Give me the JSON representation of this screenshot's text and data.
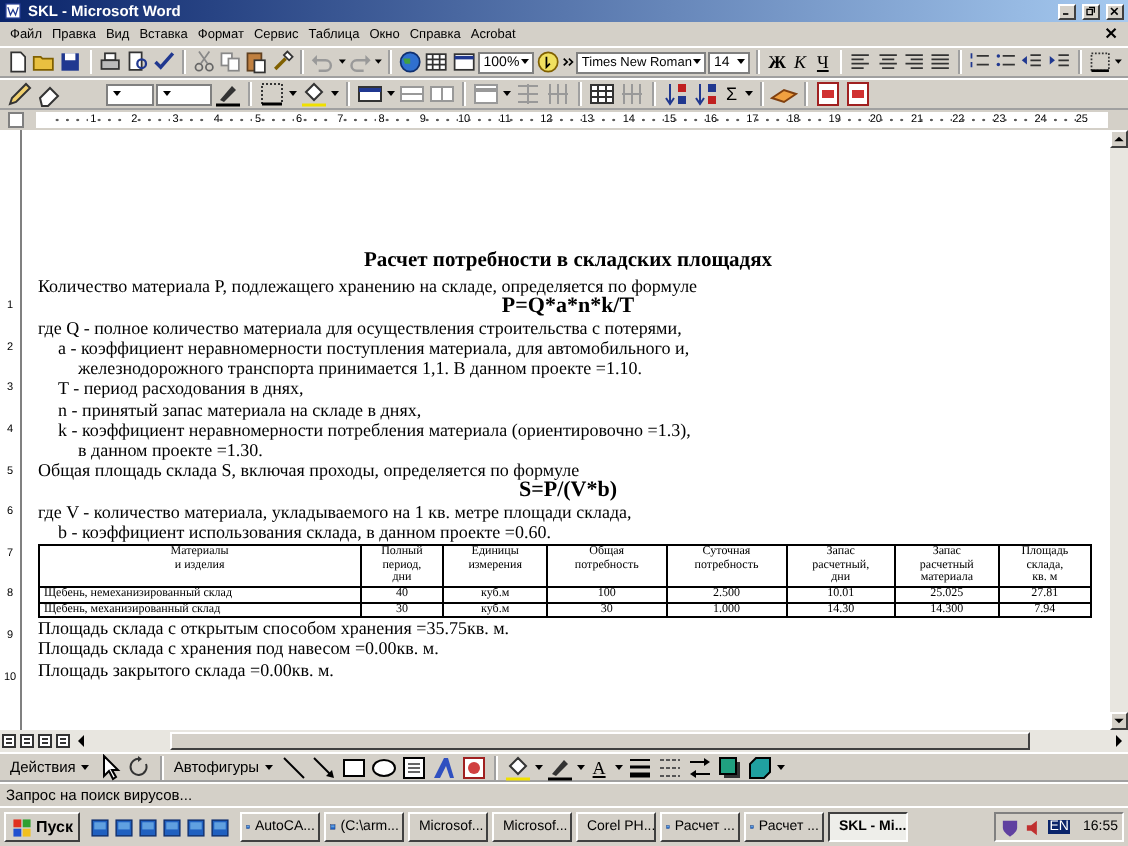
{
  "window": {
    "title": "SKL - Microsoft Word"
  },
  "menu": [
    "Файл",
    "Правка",
    "Вид",
    "Вставка",
    "Формат",
    "Сервис",
    "Таблица",
    "Окно",
    "Справка",
    "Acrobat"
  ],
  "toolbar": {
    "zoom": "100%",
    "font_name": "Times New Roman",
    "font_size": "14",
    "format_buttons": [
      {
        "label": "Ж",
        "kind": "bold"
      },
      {
        "label": "К",
        "kind": "italic"
      },
      {
        "label": "Ч",
        "kind": "underline"
      }
    ]
  },
  "tables_toolbar": {
    "sum": "Σ"
  },
  "ruler": {
    "marks": [
      "1",
      "2",
      "3",
      "4",
      "5",
      "6",
      "7",
      "8",
      "9",
      "10",
      "11",
      "12",
      "13",
      "14",
      "15",
      "16",
      "17",
      "18",
      "19",
      "20",
      "21",
      "22",
      "23",
      "24",
      "25"
    ]
  },
  "vertical_ruler": {
    "marks": [
      "1",
      "2",
      "3",
      "4",
      "5",
      "6",
      "7",
      "8",
      "9",
      "10"
    ]
  },
  "document": {
    "title": "Расчет потребности в складских площадях",
    "paragraphs": [
      {
        "kind": "para",
        "text": "Количество материала P, подлежащего хранению на складе, определяется по формуле"
      },
      {
        "kind": "formula",
        "text": "P=Q*a*n*k/T"
      },
      {
        "kind": "para",
        "text": "где Q - полное количество материала для осуществления строительства с потерями,"
      },
      {
        "kind": "item",
        "text": "a - коэффициент неравномерности поступления материала, для автомобильного и,"
      },
      {
        "kind": "cont",
        "text": "железнодорожного транспорта принимается 1,1. В данном проекте =1.10."
      },
      {
        "kind": "item",
        "text": "T - период расходования в днях,"
      },
      {
        "kind": "item",
        "text": "n - принятый запас материала на складе в днях,"
      },
      {
        "kind": "item",
        "text": "k - коэффициент неравномерности потребления материала (ориентировочно =1.3),"
      },
      {
        "kind": "cont",
        "text": "в данном проекте =1.30."
      },
      {
        "kind": "para",
        "text": "Общая площадь склада S, включая проходы, определяется по формуле"
      },
      {
        "kind": "formula",
        "text": "S=P/(V*b)"
      },
      {
        "kind": "para",
        "text": "где V - количество материала, укладываемого на 1 кв. метре площади склада,"
      },
      {
        "kind": "item",
        "text": "b - коэффициент использования склада, в данном проекте =0.60."
      }
    ],
    "table": {
      "columns": [
        "Материалы\nи изделия",
        "Полный\nпериод,\nдни",
        "Единицы\nизмерения",
        "Общая\nпотребность",
        "Суточная\nпотребность",
        "Запас\nрасчетный,\nдни",
        "Запас\nрасчетный\nматериала",
        "Площадь\nсклада,\nкв. м"
      ],
      "rows": [
        [
          "Щебень, немеханизированный склад",
          "40",
          "куб.м",
          "100",
          "2.500",
          "10.01",
          "25.025",
          "27.81"
        ],
        [
          "Щебень, механизированный склад",
          "30",
          "куб.м",
          "30",
          "1.000",
          "14.30",
          "14.300",
          "7.94"
        ]
      ]
    },
    "results": [
      "Площадь склада с открытым способом хранения =35.75кв. м.",
      "Площадь склада с хранения под навесом =0.00кв. м.",
      "Площадь закрытого склада =0.00кв. м."
    ]
  },
  "drawing_toolbar": {
    "actions": "Действия",
    "autoshapes": "Автофигуры",
    "font_color": "A"
  },
  "status_bar": {
    "text": "Запрос на поиск вирусов..."
  },
  "taskbar": {
    "start": "Пуск",
    "buttons": [
      {
        "label": "AutoCA...",
        "selected": false
      },
      {
        "label": "(C:\\arm...",
        "selected": false
      },
      {
        "label": "Microsof...",
        "selected": false
      },
      {
        "label": "Microsof...",
        "selected": false
      },
      {
        "label": "Corel PH...",
        "selected": false
      },
      {
        "label": "Расчет ...",
        "selected": false
      },
      {
        "label": "Расчет ...",
        "selected": false
      },
      {
        "label": "SKL - Mi...",
        "selected": true
      }
    ],
    "language": "EN",
    "clock": "16:55"
  }
}
